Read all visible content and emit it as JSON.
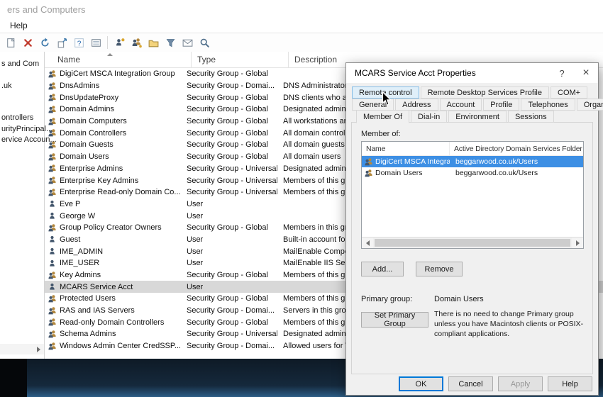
{
  "window": {
    "title": "ers and Computers",
    "menu_help": "Help"
  },
  "tree": {
    "items": [
      "s and Com",
      ".uk",
      "ontrollers",
      "urityPrincipal...",
      "ervice Accoun..."
    ]
  },
  "toolbar": {
    "icons": [
      {
        "name": "new-document-icon",
        "kind": "doc"
      },
      {
        "name": "delete-icon",
        "kind": "delete"
      },
      {
        "name": "refresh-icon",
        "kind": "refresh"
      },
      {
        "name": "export-list-icon",
        "kind": "export"
      },
      {
        "name": "help-icon",
        "kind": "help"
      },
      {
        "name": "view-list-icon",
        "kind": "list"
      },
      {
        "name": "toolbar-separator",
        "kind": "sep"
      },
      {
        "name": "add-user-icon",
        "kind": "user-add"
      },
      {
        "name": "add-group-icon",
        "kind": "group-add"
      },
      {
        "name": "add-ou-icon",
        "kind": "ou-add"
      },
      {
        "name": "set-filter-icon",
        "kind": "filter"
      },
      {
        "name": "send-mail-icon",
        "kind": "mail"
      },
      {
        "name": "find-icon",
        "kind": "find"
      }
    ]
  },
  "list": {
    "columns": [
      "Name",
      "Type",
      "Description"
    ],
    "rows": [
      {
        "icon": "group",
        "name": "DigiCert MSCA Integration Group",
        "type": "Security Group - Global",
        "desc": "",
        "selected": false
      },
      {
        "icon": "group",
        "name": "DnsAdmins",
        "type": "Security Group - Domai...",
        "desc": "DNS Administrators G",
        "selected": false
      },
      {
        "icon": "group",
        "name": "DnsUpdateProxy",
        "type": "Security Group - Global",
        "desc": "DNS clients who are p",
        "selected": false
      },
      {
        "icon": "group",
        "name": "Domain Admins",
        "type": "Security Group - Global",
        "desc": "Designated administra",
        "selected": false
      },
      {
        "icon": "group",
        "name": "Domain Computers",
        "type": "Security Group - Global",
        "desc": "All workstations and s",
        "selected": false
      },
      {
        "icon": "group",
        "name": "Domain Controllers",
        "type": "Security Group - Global",
        "desc": "All domain controllers",
        "selected": false
      },
      {
        "icon": "group",
        "name": "Domain Guests",
        "type": "Security Group - Global",
        "desc": "All domain guests",
        "selected": false
      },
      {
        "icon": "group",
        "name": "Domain Users",
        "type": "Security Group - Global",
        "desc": "All domain users",
        "selected": false
      },
      {
        "icon": "group",
        "name": "Enterprise Admins",
        "type": "Security Group - Universal",
        "desc": "Designated administra",
        "selected": false
      },
      {
        "icon": "group",
        "name": "Enterprise Key Admins",
        "type": "Security Group - Universal",
        "desc": "Members of this grou",
        "selected": false
      },
      {
        "icon": "group",
        "name": "Enterprise Read-only Domain Co...",
        "type": "Security Group - Universal",
        "desc": "Members of this grou",
        "selected": false
      },
      {
        "icon": "user",
        "name": "Eve P",
        "type": "User",
        "desc": "",
        "selected": false
      },
      {
        "icon": "user",
        "name": "George W",
        "type": "User",
        "desc": "",
        "selected": false
      },
      {
        "icon": "group",
        "name": "Group Policy Creator Owners",
        "type": "Security Group - Global",
        "desc": "Members in this grou",
        "selected": false
      },
      {
        "icon": "user",
        "name": "Guest",
        "type": "User",
        "desc": "Built-in account for gu",
        "selected": false
      },
      {
        "icon": "user",
        "name": "IME_ADMIN",
        "type": "User",
        "desc": "MailEnable Compone",
        "selected": false
      },
      {
        "icon": "user",
        "name": "IME_USER",
        "type": "User",
        "desc": "MailEnable IIS Service",
        "selected": false
      },
      {
        "icon": "group",
        "name": "Key Admins",
        "type": "Security Group - Global",
        "desc": "Members of this grou",
        "selected": false
      },
      {
        "icon": "user",
        "name": "MCARS Service Acct",
        "type": "User",
        "desc": "",
        "selected": true
      },
      {
        "icon": "group",
        "name": "Protected Users",
        "type": "Security Group - Global",
        "desc": "Members of this grou",
        "selected": false
      },
      {
        "icon": "group",
        "name": "RAS and IAS Servers",
        "type": "Security Group - Domai...",
        "desc": "Servers in this group c",
        "selected": false
      },
      {
        "icon": "group",
        "name": "Read-only Domain Controllers",
        "type": "Security Group - Global",
        "desc": "Members of this grou",
        "selected": false
      },
      {
        "icon": "group",
        "name": "Schema Admins",
        "type": "Security Group - Universal",
        "desc": "Designated administra",
        "selected": false
      },
      {
        "icon": "group",
        "name": "Windows Admin Center CredSSP...",
        "type": "Security Group - Domai...",
        "desc": "Allowed users for Win",
        "selected": false
      }
    ]
  },
  "dialog": {
    "title": "MCARS Service Acct Properties",
    "help_glyph": "?",
    "close_glyph": "×",
    "tabs": {
      "row1": [
        "Remote control",
        "Remote Desktop Services Profile",
        "COM+"
      ],
      "row2": [
        "General",
        "Address",
        "Account",
        "Profile",
        "Telephones",
        "Organization"
      ],
      "row3": [
        "Member Of",
        "Dial-in",
        "Environment",
        "Sessions"
      ],
      "selected": "Member Of",
      "hovered": "Remote control"
    },
    "member_of_label": "Member of:",
    "member_columns": [
      "Name",
      "Active Directory Domain Services Folder"
    ],
    "members": [
      {
        "name": "DigiCert MSCA Integration ...",
        "folder": "beggarwood.co.uk/Users",
        "selected": true
      },
      {
        "name": "Domain Users",
        "folder": "beggarwood.co.uk/Users",
        "selected": false
      }
    ],
    "add_label": "Add...",
    "remove_label": "Remove",
    "primary_group_label": "Primary group:",
    "primary_group_value": "Domain Users",
    "set_primary_label": "Set Primary Group",
    "primary_note": "There is no need to change Primary group unless you have Macintosh clients or POSIX-compliant applications.",
    "buttons": [
      {
        "label": "OK",
        "state": "default"
      },
      {
        "label": "Cancel",
        "state": "normal"
      },
      {
        "label": "Apply",
        "state": "disabled"
      },
      {
        "label": "Help",
        "state": "normal"
      }
    ]
  },
  "colors": {
    "selection": "#3d8fe4",
    "accent": "#0078d7",
    "row_highlight": "#d8d8d8"
  }
}
